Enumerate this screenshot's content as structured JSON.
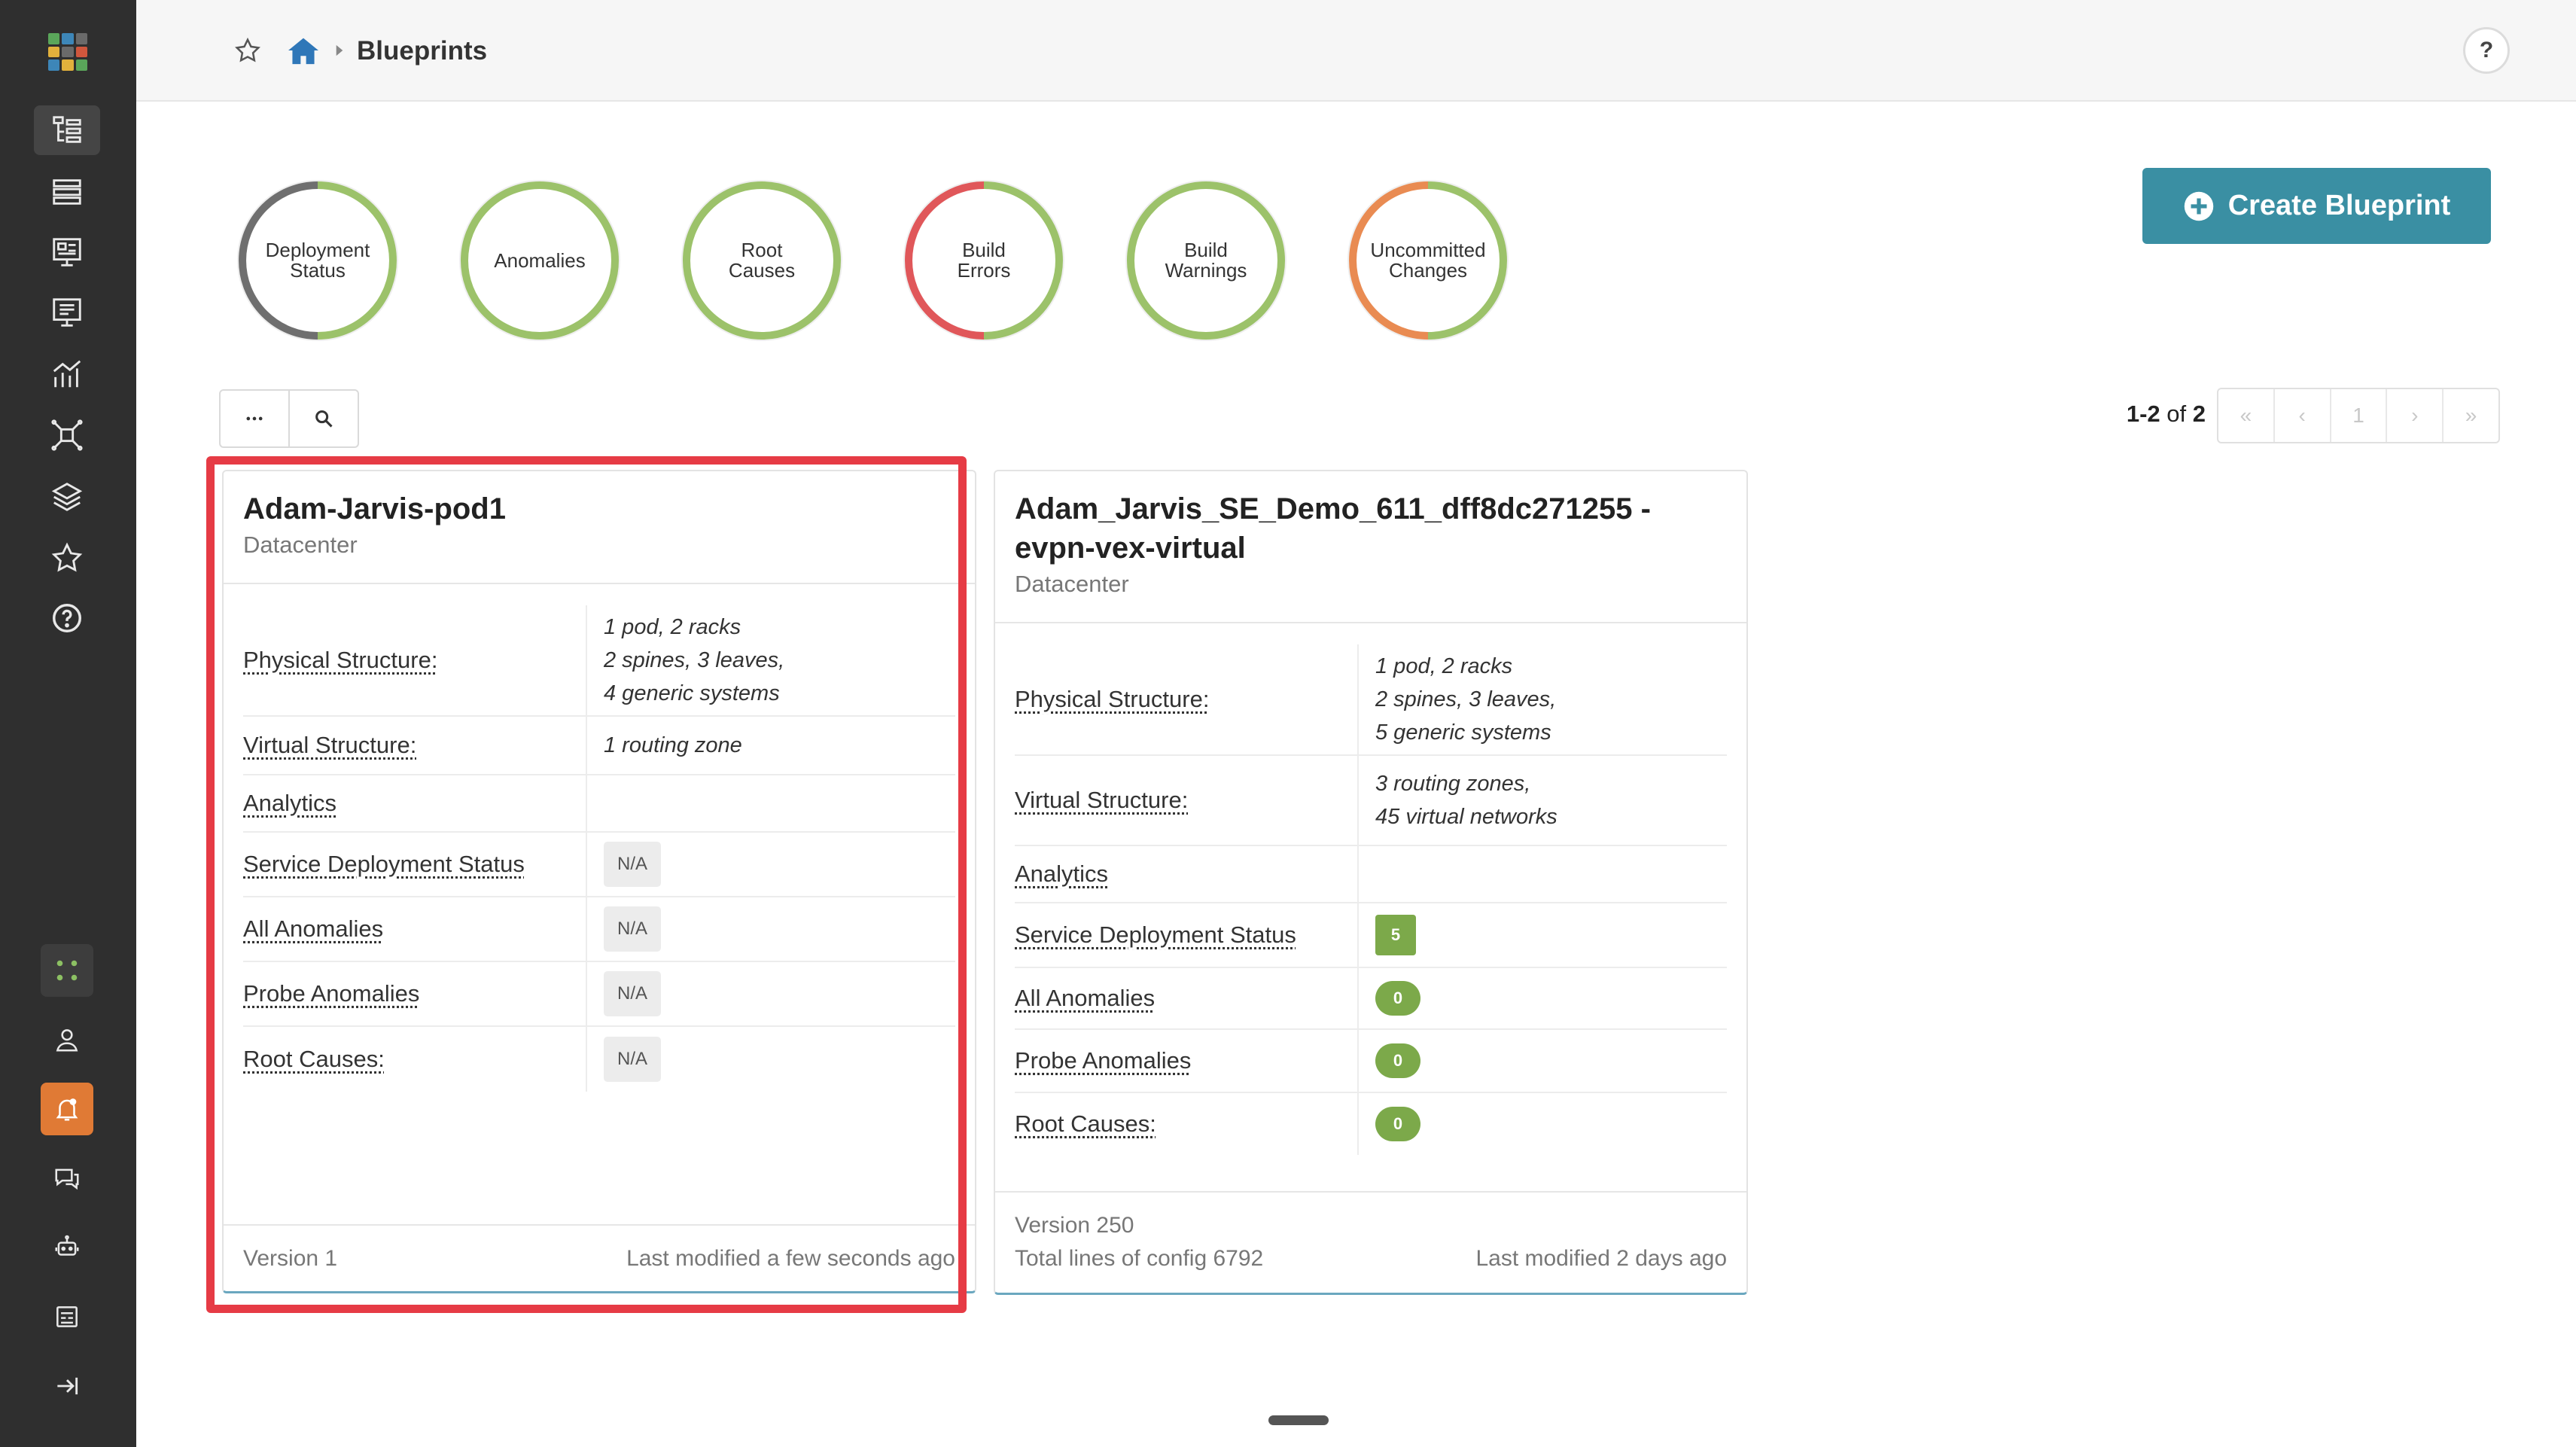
{
  "header": {
    "title": "Blueprints",
    "help_label": "?"
  },
  "status_rings": [
    {
      "label": "Deployment\nStatus",
      "color_main": "#9cc26a",
      "color_alt": "#6f6f6f"
    },
    {
      "label": "Anomalies",
      "color_main": "#9cc26a"
    },
    {
      "label": "Root\nCauses",
      "color_main": "#9cc26a"
    },
    {
      "label": "Build\nErrors",
      "color_main": "#9cc26a",
      "color_alt": "#e0575a"
    },
    {
      "label": "Build\nWarnings",
      "color_main": "#9cc26a"
    },
    {
      "label": "Uncommitted\nChanges",
      "color_main": "#9cc26a",
      "color_alt": "#e98b52"
    }
  ],
  "create_button": {
    "label": "Create Blueprint"
  },
  "pagination": {
    "range": "1-2",
    "of_label": "of",
    "total": "2",
    "first": "«",
    "prev": "‹",
    "current": "1",
    "next": "›",
    "last": "»"
  },
  "cards": [
    {
      "title": "Adam-Jarvis-pod1",
      "type": "Datacenter",
      "rows": {
        "physical_label": "Physical Structure:",
        "physical_value": "1 pod, 2 racks\n2 spines, 3 leaves,\n4 generic systems",
        "virtual_label": "Virtual Structure:",
        "virtual_value": "1 routing zone",
        "analytics_label": "Analytics",
        "service_label": "Service Deployment Status",
        "service_value": "N/A",
        "anomalies_label": "All Anomalies",
        "anomalies_value": "N/A",
        "probe_label": "Probe Anomalies",
        "probe_value": "N/A",
        "root_label": "Root Causes:",
        "root_value": "N/A"
      },
      "version": "Version 1",
      "last_modified": "Last modified a few seconds ago"
    },
    {
      "title": "Adam_Jarvis_SE_Demo_611_dff8dc271255 - evpn-vex-virtual",
      "type": "Datacenter",
      "rows": {
        "physical_label": "Physical Structure:",
        "physical_value": "1 pod, 2 racks\n2 spines, 3 leaves,\n5 generic systems",
        "virtual_label": "Virtual Structure:",
        "virtual_value": "3 routing zones,\n45 virtual networks",
        "analytics_label": "Analytics",
        "service_label": "Service Deployment Status",
        "service_value": "5",
        "anomalies_label": "All Anomalies",
        "anomalies_value": "0",
        "probe_label": "Probe Anomalies",
        "probe_value": "0",
        "root_label": "Root Causes:",
        "root_value": "0"
      },
      "version": "Version 250",
      "config_lines": "Total lines of config 6792",
      "last_modified": "Last modified 2 days ago"
    }
  ],
  "colors": {
    "sidebar_bg": "#2f2f2f",
    "accent_teal": "#3a8fa3",
    "highlight_red": "#e63b45",
    "badge_green": "#7ca94a",
    "alert_orange": "#e07a35"
  }
}
